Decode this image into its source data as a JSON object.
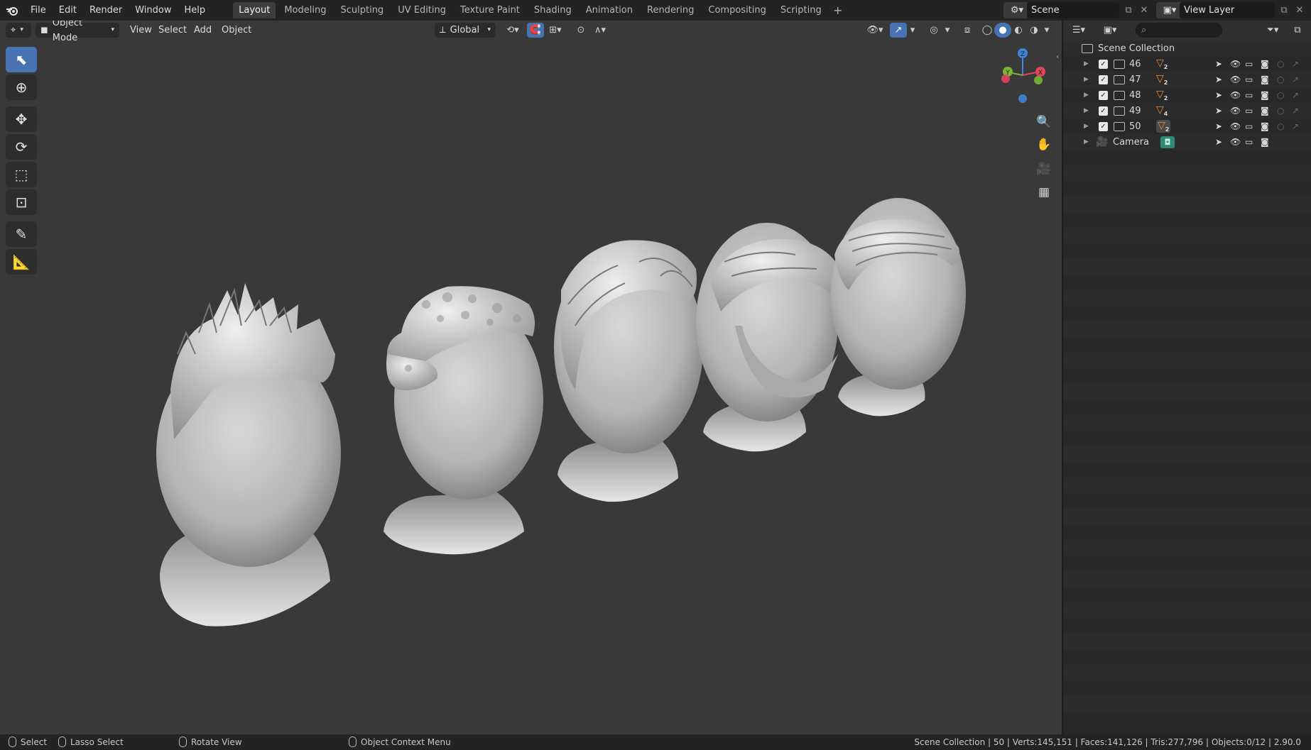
{
  "menu": [
    "File",
    "Edit",
    "Render",
    "Window",
    "Help"
  ],
  "workspaces": [
    "Layout",
    "Modeling",
    "Sculpting",
    "UV Editing",
    "Texture Paint",
    "Shading",
    "Animation",
    "Rendering",
    "Compositing",
    "Scripting"
  ],
  "active_workspace": "Layout",
  "scene": {
    "label": "Scene"
  },
  "view_layer": {
    "label": "View Layer"
  },
  "viewport_header": {
    "mode": "Object Mode",
    "menus": [
      "View",
      "Select",
      "Add",
      "Object"
    ],
    "transform_orientation": "Global"
  },
  "outliner": {
    "root": "Scene Collection",
    "rows": [
      {
        "name": "46",
        "type": "collection",
        "mesh_badge": "2"
      },
      {
        "name": "47",
        "type": "collection",
        "mesh_badge": "2"
      },
      {
        "name": "48",
        "type": "collection",
        "mesh_badge": "2"
      },
      {
        "name": "49",
        "type": "collection",
        "mesh_badge": "4"
      },
      {
        "name": "50",
        "type": "collection",
        "mesh_badge": "2"
      },
      {
        "name": "Camera",
        "type": "camera"
      }
    ]
  },
  "statusbar": {
    "select": "Select",
    "lasso": "Lasso Select",
    "rotate": "Rotate View",
    "context": "Object Context Menu",
    "stats": "Scene Collection | 50 | Verts:145,151 | Faces:141,126 | Tris:277,796 | Objects:0/12 | 2.90.0"
  },
  "colors": {
    "accent": "#4772b3",
    "viewport_bg": "#393939",
    "mesh_orange": "#e28a3b",
    "axis_x": "#e0455a",
    "axis_y": "#7ab535",
    "axis_z": "#3f86dc"
  },
  "icons": {
    "toolbar": [
      "select-box-icon",
      "cursor-icon",
      "move-icon",
      "rotate-icon",
      "scale-icon",
      "transform-icon",
      "annotate-icon",
      "measure-icon"
    ],
    "nav": [
      "zoom-icon",
      "pan-hand-icon",
      "camera-view-icon",
      "grid-ortho-icon"
    ]
  }
}
